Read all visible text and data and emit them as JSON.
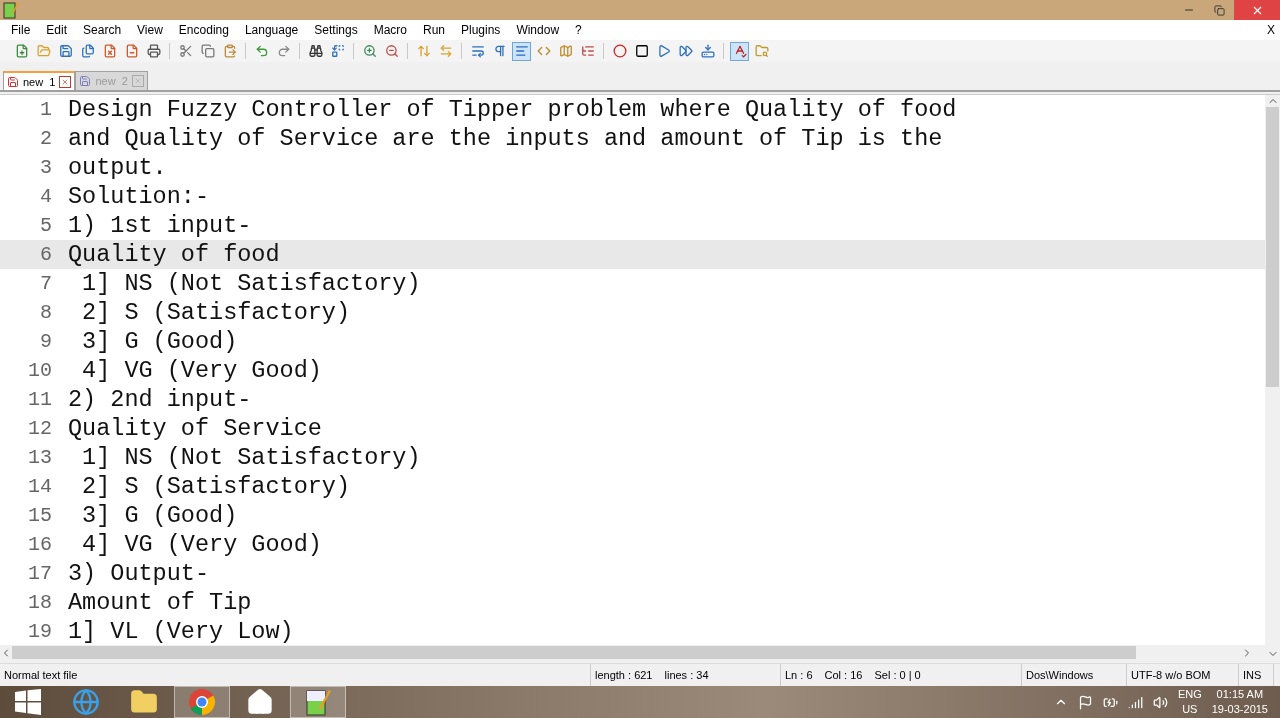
{
  "menu": [
    "File",
    "Edit",
    "Search",
    "View",
    "Encoding",
    "Language",
    "Settings",
    "Macro",
    "Run",
    "Plugins",
    "Window",
    "?"
  ],
  "menu_close": "X",
  "toolbar": [
    {
      "kind": "new",
      "pressed": false
    },
    {
      "kind": "open",
      "pressed": false
    },
    {
      "kind": "save",
      "pressed": false
    },
    {
      "kind": "saveall",
      "pressed": false
    },
    {
      "kind": "close",
      "pressed": false
    },
    {
      "kind": "closeall",
      "pressed": false
    },
    {
      "kind": "print",
      "pressed": false
    },
    {
      "kind": "sep"
    },
    {
      "kind": "cut",
      "pressed": false
    },
    {
      "kind": "copy",
      "pressed": false
    },
    {
      "kind": "paste",
      "pressed": false
    },
    {
      "kind": "sep"
    },
    {
      "kind": "undo",
      "pressed": false
    },
    {
      "kind": "redo",
      "pressed": false
    },
    {
      "kind": "sep"
    },
    {
      "kind": "find",
      "pressed": false
    },
    {
      "kind": "replace",
      "pressed": false
    },
    {
      "kind": "sep"
    },
    {
      "kind": "zoomin",
      "pressed": false
    },
    {
      "kind": "zoomout",
      "pressed": false
    },
    {
      "kind": "sep"
    },
    {
      "kind": "syncv",
      "pressed": false
    },
    {
      "kind": "synch",
      "pressed": false
    },
    {
      "kind": "sep"
    },
    {
      "kind": "wrap",
      "pressed": false
    },
    {
      "kind": "allchars",
      "pressed": false
    },
    {
      "kind": "indent",
      "pressed": true
    },
    {
      "kind": "udl",
      "pressed": false
    },
    {
      "kind": "map",
      "pressed": false
    },
    {
      "kind": "func",
      "pressed": false
    },
    {
      "kind": "sep"
    },
    {
      "kind": "record",
      "pressed": false
    },
    {
      "kind": "stop",
      "pressed": false
    },
    {
      "kind": "play",
      "pressed": false
    },
    {
      "kind": "playmulti",
      "pressed": false
    },
    {
      "kind": "savemacro",
      "pressed": false
    },
    {
      "kind": "sep"
    },
    {
      "kind": "spell",
      "pressed": true
    },
    {
      "kind": "folder",
      "pressed": false
    }
  ],
  "tabs": [
    {
      "label": "new  1",
      "selected": true
    },
    {
      "label": "new  2",
      "selected": false
    }
  ],
  "lines": [
    {
      "number": "1",
      "text": "Design Fuzzy Controller of Tipper problem where Quality of food",
      "current": false
    },
    {
      "number": "2",
      "text": "and Quality of Service are the inputs and amount of Tip is the",
      "current": false
    },
    {
      "number": "3",
      "text": "output.",
      "current": false
    },
    {
      "number": "4",
      "text": "Solution:-",
      "current": false
    },
    {
      "number": "5",
      "text": "1) 1st input-",
      "current": false
    },
    {
      "number": "6",
      "text": "Quality of food",
      "current": true
    },
    {
      "number": "7",
      "text": " 1] NS (Not Satisfactory)",
      "current": false
    },
    {
      "number": "8",
      "text": " 2] S (Satisfactory)",
      "current": false
    },
    {
      "number": "9",
      "text": " 3] G (Good)",
      "current": false
    },
    {
      "number": "10",
      "text": " 4] VG (Very Good)",
      "current": false
    },
    {
      "number": "11",
      "text": "2) 2nd input-",
      "current": false
    },
    {
      "number": "12",
      "text": "Quality of Service",
      "current": false
    },
    {
      "number": "13",
      "text": " 1] NS (Not Satisfactory)",
      "current": false
    },
    {
      "number": "14",
      "text": " 2] S (Satisfactory)",
      "current": false
    },
    {
      "number": "15",
      "text": " 3] G (Good)",
      "current": false
    },
    {
      "number": "16",
      "text": " 4] VG (Very Good)",
      "current": false
    },
    {
      "number": "17",
      "text": "3) Output-",
      "current": false
    },
    {
      "number": "18",
      "text": "Amount of Tip",
      "current": false
    },
    {
      "number": "19",
      "text": "1] VL (Very Low)",
      "current": false
    }
  ],
  "status_bar": {
    "file_type": "Normal text file",
    "length": "length : 621",
    "lines": "lines : 34",
    "ln": "Ln : 6",
    "col": "Col : 16",
    "sel": "Sel : 0 | 0",
    "eol": "Dos\\Windows",
    "encoding": "UTF-8 w/o BOM",
    "mode": "INS"
  },
  "taskbar": {
    "apps": [
      {
        "kind": "start",
        "selected": false
      },
      {
        "kind": "browser",
        "selected": false
      },
      {
        "kind": "explorer",
        "selected": false
      },
      {
        "kind": "chrome",
        "selected": true
      },
      {
        "kind": "home",
        "selected": false
      },
      {
        "kind": "notepad",
        "selected": true
      }
    ],
    "language": "ENG",
    "region": "US",
    "time": "01:15 AM",
    "date": "19-03-2015"
  }
}
